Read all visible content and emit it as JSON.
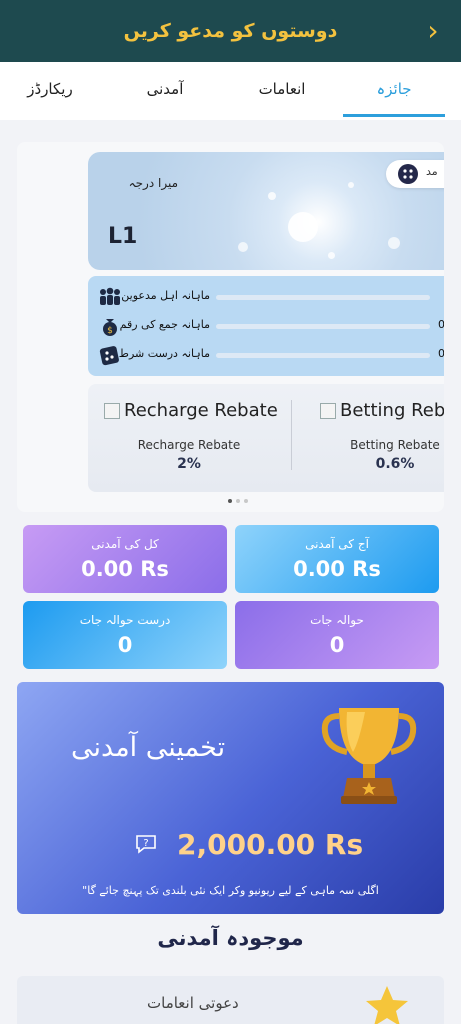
{
  "header": {
    "title": "دوستوں کو مدعو کریں",
    "back_icon": "chevron-right-icon",
    "background": "#1e4a4f",
    "title_color": "#f3c23f"
  },
  "tabs": [
    {
      "label": "جائزہ",
      "active": true
    },
    {
      "label": "انعامات",
      "active": false
    },
    {
      "label": "آمدنی",
      "active": false
    },
    {
      "label": "ریکارڈز",
      "active": false
    }
  ],
  "rank": {
    "label": "میرا درجہ",
    "level": "L1",
    "pill_text": "مد"
  },
  "monthly_progress": [
    {
      "label": "ماہانہ اہل مدعوین",
      "value": "",
      "icon": "people-icon"
    },
    {
      "label": "ماہانہ جمع کی رقم",
      "value": "0",
      "icon": "money-bag-icon"
    },
    {
      "label": "ماہانہ درست شرط",
      "value": "0/",
      "icon": "dice-icon"
    }
  ],
  "rebates": [
    {
      "image_alt": "Recharge Rebate",
      "name": "Recharge Rebate",
      "value": "2%"
    },
    {
      "image_alt": "Betting Rebate",
      "name": "Betting Rebate",
      "value": "0.6%"
    }
  ],
  "stats": {
    "total_income": {
      "label": "کل کی آمدنی",
      "value": "0.00 Rs"
    },
    "today_income": {
      "label": "آج کی آمدنی",
      "value": "0.00 Rs"
    },
    "valid_referrals": {
      "label": "درست حوالہ جات",
      "value": "0"
    },
    "referrals": {
      "label": "حوالہ جات",
      "value": "0"
    }
  },
  "estimate": {
    "title": "تخمینی آمدنی",
    "amount": "2,000.00 Rs",
    "note": "اگلی سہ ماہی کے لیے ریونیو وکر ایک نئی بلندی تک پہنچ جائے گا\"",
    "trophy_icon": "trophy-icon",
    "info_icon": "chat-question-icon"
  },
  "current_income": {
    "title": "موجودہ آمدنی"
  },
  "bottom_card": {
    "label": "دعوتی انعامات",
    "icon": "star-icon"
  },
  "colors": {
    "accent": "#2d9fdc",
    "purple_start": "#c79bf4",
    "blue_end": "#1d9bf0",
    "amount": "#ffd28a"
  }
}
